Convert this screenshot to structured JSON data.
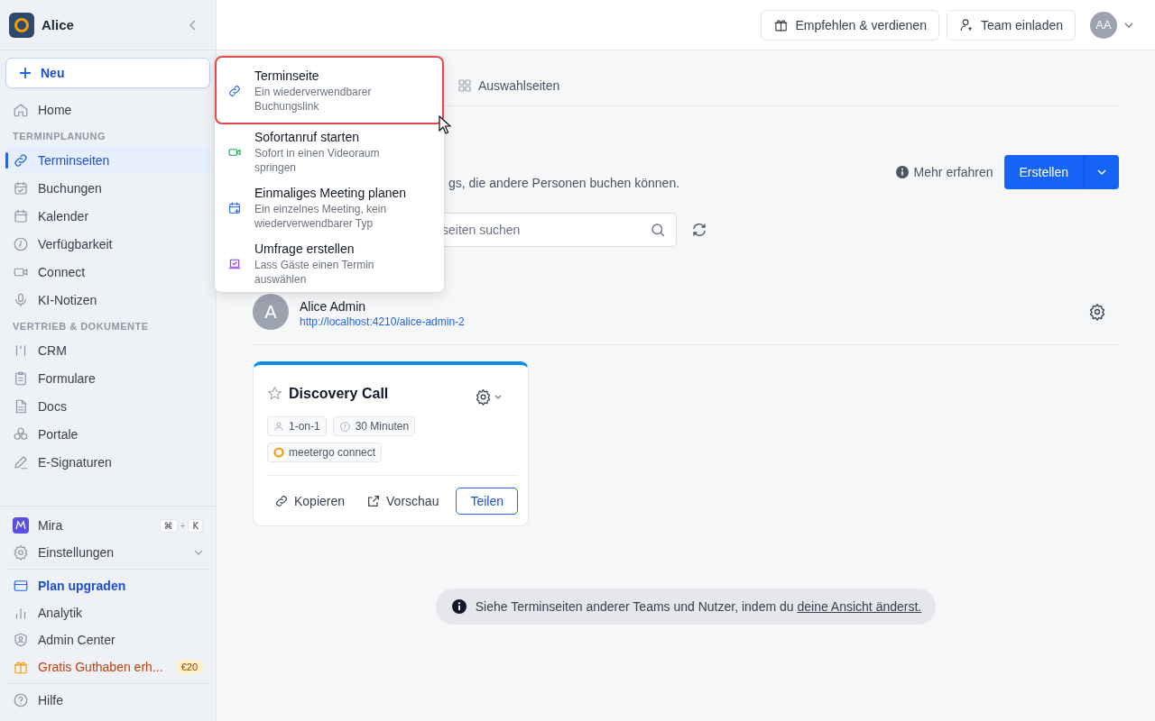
{
  "sidebar": {
    "workspace": "Alice",
    "new_button": "Neu",
    "items": [
      {
        "kind": "item",
        "label": "Home",
        "selected": false
      },
      {
        "kind": "section",
        "label": "TERMINPLANUNG"
      },
      {
        "kind": "item",
        "label": "Terminseiten",
        "selected": true
      },
      {
        "kind": "item",
        "label": "Buchungen",
        "selected": false
      },
      {
        "kind": "item",
        "label": "Kalender",
        "selected": false
      },
      {
        "kind": "item",
        "label": "Verfügbarkeit",
        "selected": false
      },
      {
        "kind": "item",
        "label": "Connect",
        "selected": false
      },
      {
        "kind": "item",
        "label": "KI-Notizen",
        "selected": false
      },
      {
        "kind": "section",
        "label": "VERTRIEB & DOKUMENTE"
      },
      {
        "kind": "item",
        "label": "CRM",
        "selected": false
      },
      {
        "kind": "item",
        "label": "Formulare",
        "selected": false
      },
      {
        "kind": "item",
        "label": "Docs",
        "selected": false
      },
      {
        "kind": "item",
        "label": "Portale",
        "selected": false
      },
      {
        "kind": "item",
        "label": "E-Signaturen",
        "selected": false
      }
    ],
    "bottom_items": [
      {
        "kind": "assistant",
        "label": "Mira",
        "shortcut": [
          "⌘",
          "+",
          "K"
        ]
      },
      {
        "kind": "settings",
        "label": "Einstellungen",
        "expanded": false
      },
      {
        "kind": "divider"
      },
      {
        "kind": "accent",
        "label": "Plan upgraden"
      },
      {
        "kind": "plain",
        "label": "Analytik"
      },
      {
        "kind": "plain",
        "label": "Admin Center"
      },
      {
        "kind": "promo",
        "label": "Gratis Guthaben erh...",
        "badge": "€20"
      },
      {
        "kind": "divider"
      },
      {
        "kind": "plain",
        "label": "Hilfe"
      }
    ]
  },
  "topbar": {
    "buttons": [
      "Empfehlen & verdienen",
      "Team einladen"
    ],
    "avatar": "AA"
  },
  "tabs": [
    {
      "label": "Auswahlseiten",
      "selected": false
    }
  ],
  "description": "gs, die andere Personen buchen können.",
  "learn_more": "Mehr erfahren",
  "create_button": "Erstellen",
  "search": {
    "placeholder": "seiten suchen"
  },
  "profile": {
    "initial": "A",
    "name": "Alice Admin",
    "url": "http://localhost:4210/alice-admin-2"
  },
  "cards": [
    {
      "title": "Discovery Call",
      "starred": false,
      "tags": [
        {
          "kind": "person",
          "label": "1-on-1"
        },
        {
          "kind": "duration",
          "label": "30 Minuten"
        },
        {
          "kind": "connect",
          "label": "meetergo connect"
        }
      ],
      "actions": [
        "Kopieren",
        "Vorschau"
      ],
      "share": "Teilen"
    }
  ],
  "notice": {
    "text": "Siehe Terminseiten anderer Teams und Nutzer, indem du ",
    "link": "deine Ansicht änderst."
  },
  "create_menu": [
    {
      "title": "Terminseite",
      "description": "Ein wiederverwendbarer Buchungslink",
      "selected": true
    },
    {
      "title": "Sofortanruf starten",
      "description": "Sofort in einen Videoraum springen",
      "selected": false
    },
    {
      "title": "Einmaliges Meeting planen",
      "description": "Ein einzelnes Meeting, kein wiederverwendbarer Typ",
      "selected": false
    },
    {
      "title": "Umfrage erstellen",
      "description": "Lass Gäste einen Termin auswählen",
      "selected": false
    }
  ]
}
